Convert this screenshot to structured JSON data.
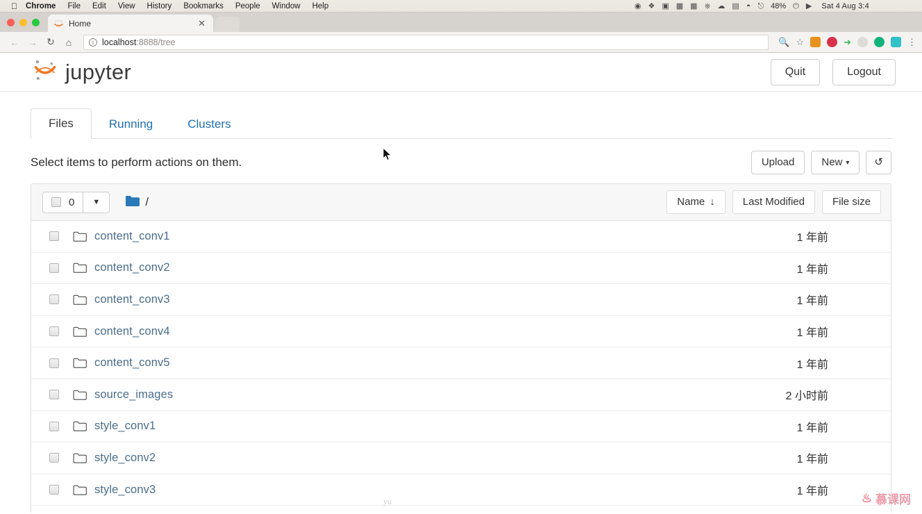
{
  "os_menubar": {
    "apple_icon": "apple-logo",
    "items": [
      {
        "label": "Chrome",
        "bold": true
      },
      {
        "label": "File",
        "bold": false
      },
      {
        "label": "Edit",
        "bold": false
      },
      {
        "label": "View",
        "bold": false
      },
      {
        "label": "History",
        "bold": false
      },
      {
        "label": "Bookmarks",
        "bold": false
      },
      {
        "label": "People",
        "bold": false
      },
      {
        "label": "Window",
        "bold": false
      },
      {
        "label": "Help",
        "bold": false
      }
    ],
    "status_icons": [
      "record-icon",
      "dropbox-icon",
      "sync-icon",
      "shield-icon",
      "screenshot-icon",
      "airplay-icon",
      "cloud-icon",
      "battery-bars-icon"
    ],
    "wifi_icon": "wifi-icon",
    "input_icon": "input-source-icon",
    "battery_percent": "48%",
    "battery_icon": "battery-charging-icon",
    "sync_icon": "dropbox-sync-icon",
    "clock": "Sat 4 Aug  3:4"
  },
  "browser": {
    "traffic_lights": [
      "close-red",
      "minimize-yellow",
      "maximize-green"
    ],
    "tab": {
      "title": "Home",
      "favicon": "jupyter-favicon",
      "close_icon": "close-icon"
    },
    "nav": {
      "back_icon": "back-arrow-icon",
      "forward_icon": "forward-arrow-icon",
      "reload_icon": "reload-icon",
      "home_icon": "home-icon"
    },
    "omnibox": {
      "info_icon": "info-circle-icon",
      "host": "localhost",
      "path": ":8888/tree",
      "zoom_icon": "zoom-search-icon",
      "bookmark_icon": "star-icon"
    },
    "extensions": [
      "extension-orange-icon",
      "opera-icon",
      "green-arrow-icon",
      "shield-grey-icon",
      "linkedin-icon",
      "window-capture-icon"
    ],
    "menu_icon": "kebab-menu-icon"
  },
  "jupyter": {
    "logo": {
      "icon": "jupyter-logo-icon",
      "wordmark": "jupyter"
    },
    "header_buttons": [
      {
        "label": "Quit",
        "name": "quit-button"
      },
      {
        "label": "Logout",
        "name": "logout-button"
      }
    ],
    "tabs": [
      {
        "label": "Files",
        "active": true
      },
      {
        "label": "Running",
        "active": false
      },
      {
        "label": "Clusters",
        "active": false
      }
    ],
    "action_hint": "Select items to perform actions on them.",
    "action_buttons": {
      "upload": "Upload",
      "new": "New",
      "new_caret": "▾",
      "refresh_icon": "refresh-icon"
    },
    "list_toolbar": {
      "select_count": "0",
      "select_checkbox": "select-all-checkbox",
      "dropdown_caret": "▼",
      "folder_icon": "folder-filled-icon",
      "breadcrumb_root": "/",
      "sort": [
        {
          "label": "Name",
          "arrow": "↓",
          "name": "sort-name-button"
        },
        {
          "label": "Last Modified",
          "arrow": "",
          "name": "sort-last-modified-button"
        },
        {
          "label": "File size",
          "arrow": "",
          "name": "sort-file-size-button"
        }
      ]
    },
    "files": [
      {
        "name": "content_conv1",
        "icon": "folder-outline-icon",
        "modified": "1 年前"
      },
      {
        "name": "content_conv2",
        "icon": "folder-outline-icon",
        "modified": "1 年前"
      },
      {
        "name": "content_conv3",
        "icon": "folder-outline-icon",
        "modified": "1 年前"
      },
      {
        "name": "content_conv4",
        "icon": "folder-outline-icon",
        "modified": "1 年前"
      },
      {
        "name": "content_conv5",
        "icon": "folder-outline-icon",
        "modified": "1 年前"
      },
      {
        "name": "source_images",
        "icon": "folder-outline-icon",
        "modified": "2 小时前"
      },
      {
        "name": "style_conv1",
        "icon": "folder-outline-icon",
        "modified": "1 年前"
      },
      {
        "name": "style_conv2",
        "icon": "folder-outline-icon",
        "modified": "1 年前"
      },
      {
        "name": "style_conv3",
        "icon": "folder-outline-icon",
        "modified": "1 年前"
      }
    ]
  },
  "watermark": {
    "flame": "🔥",
    "text": "慕课网",
    "ghost": "yu"
  },
  "colors": {
    "jupyter_orange": "#f37726",
    "link_blue": "#4a6d8c",
    "tab_blue": "#1f6fb5",
    "folder_blue": "#2a7ab9"
  }
}
